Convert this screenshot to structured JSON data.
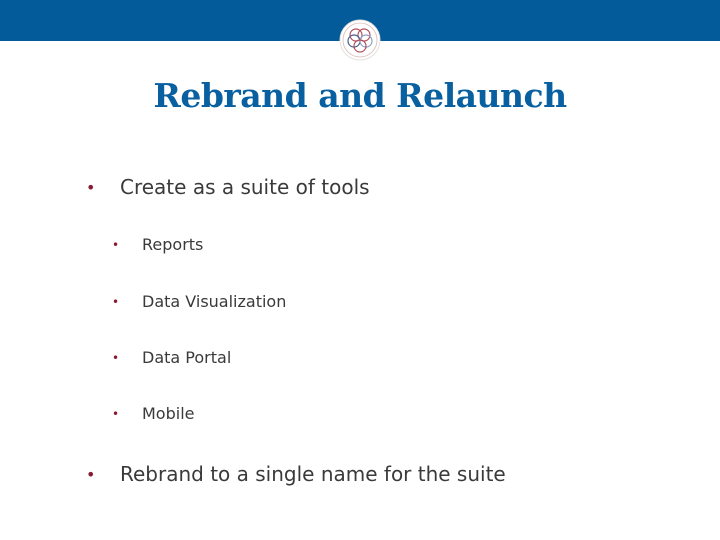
{
  "header": {
    "band_color": "#035c99",
    "logo_icon": "interlocking-rings-logo"
  },
  "slide": {
    "title": "Rebrand and Relaunch",
    "title_color": "#0860a0",
    "bullet_color": "#8b1a34",
    "bullets": [
      {
        "text": "Create as a suite of tools",
        "children": [
          {
            "text": "Reports"
          },
          {
            "text": "Data Visualization"
          },
          {
            "text": "Data Portal"
          },
          {
            "text": "Mobile"
          }
        ]
      },
      {
        "text": "Rebrand to a single name for the suite",
        "children": []
      }
    ],
    "bullet_glyph": "•"
  }
}
